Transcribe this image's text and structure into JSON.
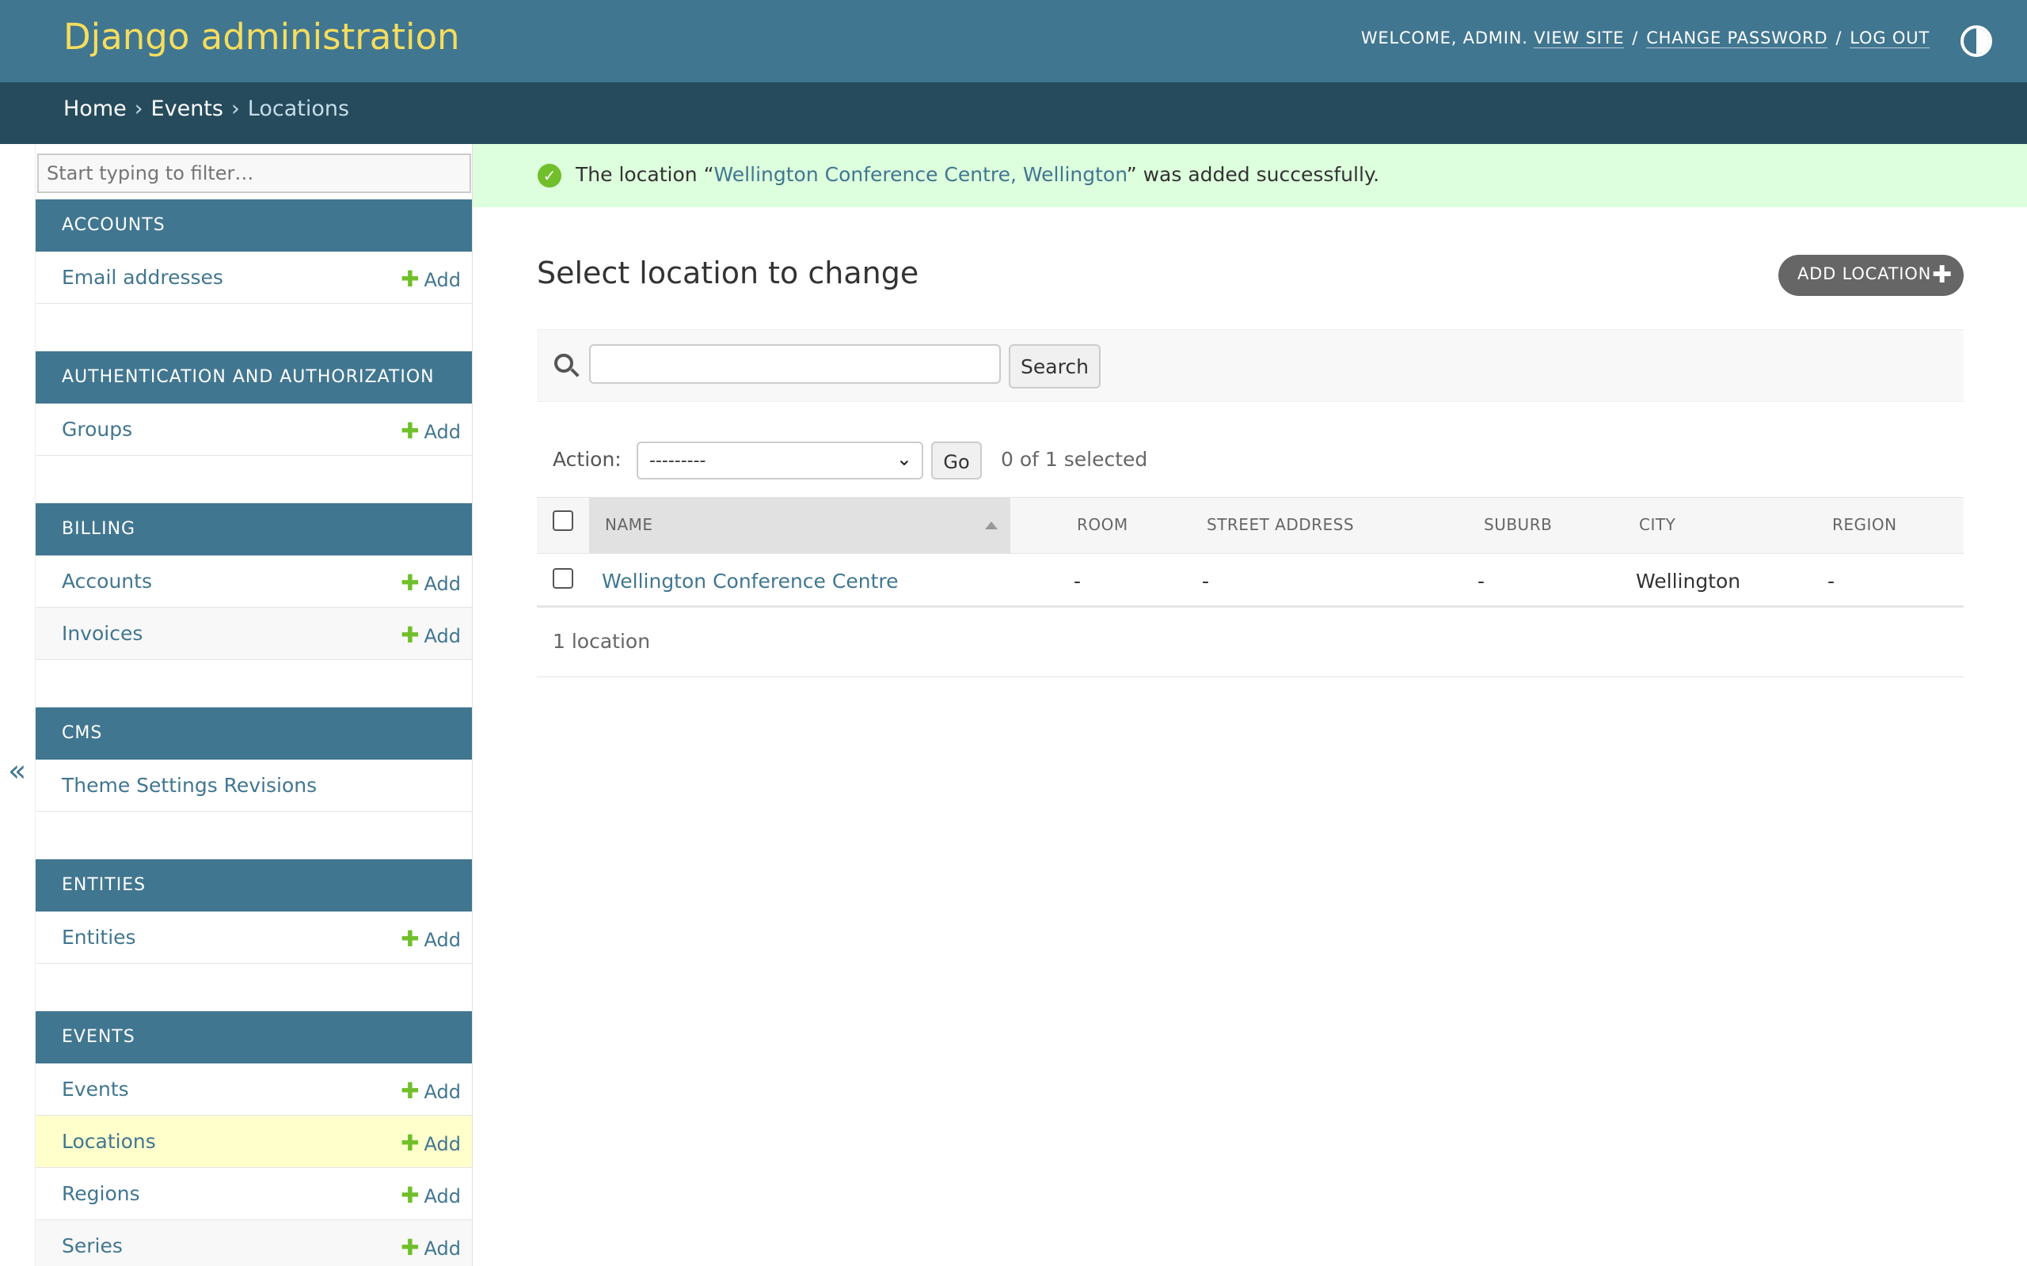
{
  "header": {
    "site_name": "Django administration",
    "welcome": "WELCOME, ADMIN.",
    "view_site": "VIEW SITE",
    "change_password": "CHANGE PASSWORD",
    "log_out": "LOG OUT",
    "separator": "/"
  },
  "breadcrumbs": {
    "home": "Home",
    "events": "Events",
    "current": "Locations",
    "separator": "›"
  },
  "sidebar": {
    "filter_placeholder": "Start typing to filter…",
    "collapse_glyph": "«",
    "add_label": "Add",
    "modules": [
      {
        "caption": "ACCOUNTS",
        "models": [
          {
            "name": "Email addresses",
            "has_add": true
          }
        ]
      },
      {
        "caption": "AUTHENTICATION AND AUTHORIZATION",
        "models": [
          {
            "name": "Groups",
            "has_add": true
          }
        ]
      },
      {
        "caption": "BILLING",
        "models": [
          {
            "name": "Accounts",
            "has_add": true
          },
          {
            "name": "Invoices",
            "has_add": true
          }
        ]
      },
      {
        "caption": "CMS",
        "models": [
          {
            "name": "Theme Settings Revisions",
            "has_add": false
          }
        ]
      },
      {
        "caption": "ENTITIES",
        "models": [
          {
            "name": "Entities",
            "has_add": true
          }
        ]
      },
      {
        "caption": "EVENTS",
        "models": [
          {
            "name": "Events",
            "has_add": true
          },
          {
            "name": "Locations",
            "has_add": true,
            "current": true
          },
          {
            "name": "Regions",
            "has_add": true
          },
          {
            "name": "Series",
            "has_add": true
          }
        ]
      }
    ]
  },
  "message": {
    "prefix": "The location “",
    "link": "Wellington Conference Centre, Wellington",
    "suffix": "” was added successfully."
  },
  "content": {
    "title": "Select location to change",
    "add_button": "ADD LOCATION",
    "search_button": "Search",
    "search_value": "",
    "action_label": "Action:",
    "action_selected": "---------",
    "go_button": "Go",
    "selected_count": "0 of 1 selected",
    "columns": [
      "NAME",
      "ROOM",
      "STREET ADDRESS",
      "SUBURB",
      "CITY",
      "REGION"
    ],
    "rows": [
      {
        "name": "Wellington Conference Centre",
        "room": "-",
        "street_address": "-",
        "suburb": "-",
        "city": "Wellington",
        "region": "-"
      }
    ],
    "paginator": "1 location"
  },
  "colors": {
    "header_bg": "#417690",
    "breadcrumb_bg": "#264b5d",
    "site_name": "#f5dd5d",
    "link": "#417690",
    "success_bg": "#ddffdd",
    "add_plus": "#70bf2b",
    "current_row": "#ffffcc"
  }
}
